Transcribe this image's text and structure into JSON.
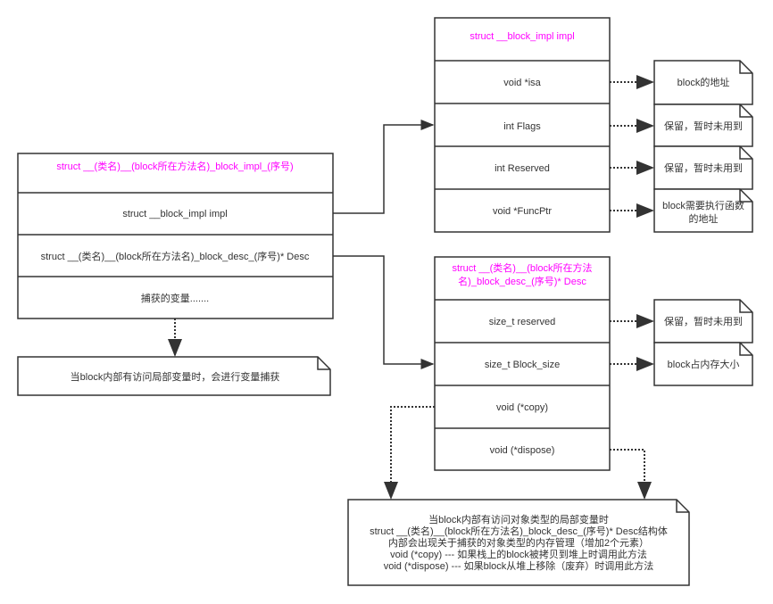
{
  "main_struct": {
    "title": "struct __(类名)__(block所在方法名)_block_impl_(序号)",
    "rows": [
      "struct __block_impl impl",
      "struct __(类名)__(block所在方法名)_block_desc_(序号)* Desc",
      "捕获的变量......."
    ]
  },
  "impl_struct": {
    "title": "struct __block_impl impl",
    "rows": [
      "void *isa",
      "int Flags",
      "int Reserved",
      "void *FuncPtr"
    ]
  },
  "impl_notes": [
    [
      "block的地址"
    ],
    [
      "保留，暂时未用到"
    ],
    [
      "保留，暂时未用到"
    ],
    [
      "block需要执行函数",
      "的地址"
    ]
  ],
  "desc_struct": {
    "title_lines": [
      "struct __(类名)__(block所在方法",
      "名)_block_desc_(序号)* Desc"
    ],
    "rows": [
      "size_t reserved",
      "size_t Block_size",
      "void (*copy)",
      "void (*dispose)"
    ]
  },
  "desc_notes": [
    "保留，暂时未用到",
    "block占内存大小"
  ],
  "capture_note": "当block内部有访问局部变量时，会进行变量捕获",
  "object_note": [
    "当block内部有访问对象类型的局部变量时",
    "struct __(类名)__(block所在方法名)_block_desc_(序号)* Desc结构体",
    "内部会出现关于捕获的对象类型的内存管理（增加2个元素）",
    "void (*copy) --- 如果栈上的block被拷贝到堆上时调用此方法",
    "void (*dispose) --- 如果block从堆上移除（废弃）时调用此方法"
  ],
  "colors": {
    "header": "#ff00ff",
    "stroke": "#333333"
  }
}
